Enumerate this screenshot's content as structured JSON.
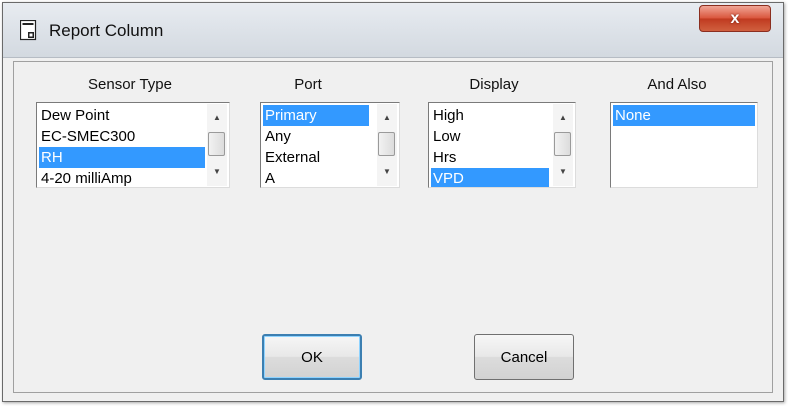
{
  "window": {
    "title": "Report Column",
    "close_glyph": "x"
  },
  "columns": [
    {
      "label": "Sensor Type",
      "items": [
        "Dew Point",
        "EC-SMEC300",
        "RH",
        "4-20 milliAmp"
      ],
      "selected": 2,
      "scrollbar": true
    },
    {
      "label": "Port",
      "items": [
        "Primary",
        "Any",
        "External",
        "A"
      ],
      "selected": 0,
      "scrollbar": true
    },
    {
      "label": "Display",
      "items": [
        "High",
        "Low",
        "Hrs",
        "VPD"
      ],
      "selected": 3,
      "scrollbar": true
    },
    {
      "label": "And Also",
      "items": [
        "None"
      ],
      "selected": 0,
      "scrollbar": false
    }
  ],
  "buttons": {
    "ok": "OK",
    "cancel": "Cancel"
  },
  "colors": {
    "selection": "#3399ff",
    "close": "#c8452c"
  },
  "icons": {
    "app": "dialog-icon",
    "scroll_up": "up-arrow-icon",
    "scroll_down": "down-arrow-icon"
  }
}
